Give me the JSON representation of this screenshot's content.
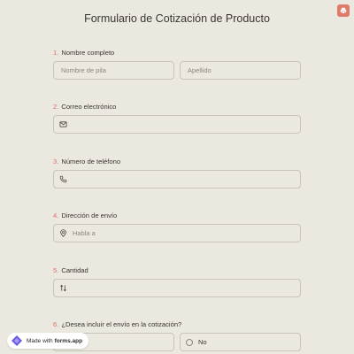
{
  "form": {
    "title": "Formulario de Cotización de Producto"
  },
  "questions": {
    "q1": {
      "number": "1.",
      "label": "Nombre completo",
      "first_placeholder": "Nombre de pila",
      "last_placeholder": "Apellido"
    },
    "q2": {
      "number": "2.",
      "label": "Correo electrónico",
      "icon": "envelope-icon"
    },
    "q3": {
      "number": "3.",
      "label": "Número de teléfono",
      "icon": "phone-icon"
    },
    "q4": {
      "number": "4.",
      "label": "Dirección de envío",
      "placeholder": "Habla a",
      "icon": "location-pin-icon"
    },
    "q5": {
      "number": "5.",
      "label": "Cantidad",
      "icon": "sort-arrows-icon"
    },
    "q6": {
      "number": "6.",
      "label": "¿Desea incluir el envío en la cotización?",
      "option_no": "No"
    }
  },
  "badge": {
    "made_with": "Made with",
    "brand": "forms.app"
  },
  "colors": {
    "background": "#ebe8df",
    "accent": "#d9706a",
    "border": "#c9c5bc"
  }
}
